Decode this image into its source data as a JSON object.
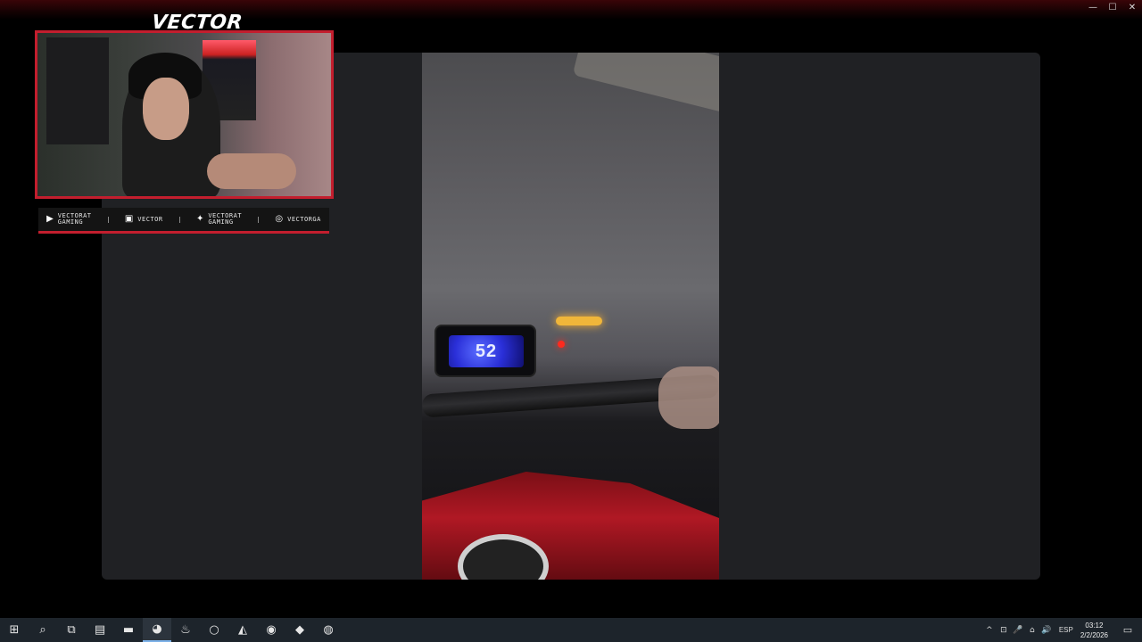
{
  "window": {
    "minimize_glyph": "—",
    "maximize_glyph": "☐",
    "close_glyph": "✕"
  },
  "overlay": {
    "logo_text": "VECTOR",
    "accent_color": "#c31e2e",
    "socials": [
      {
        "icon": "youtube-icon",
        "glyph": "▶",
        "text": "VECTORAT\nGAMING"
      },
      {
        "icon": "twitch-icon",
        "glyph": "▣",
        "text": "VECTOR"
      },
      {
        "icon": "twitter-icon",
        "glyph": "✦",
        "text": "VECTORAT\nGAMING"
      },
      {
        "icon": "instagram-icon",
        "glyph": "◎",
        "text": "VECTORGA"
      }
    ]
  },
  "video": {
    "dash_speed": "52"
  },
  "taskbar": {
    "apps": [
      {
        "name": "windows-start-icon",
        "glyph": "⊞"
      },
      {
        "name": "search-icon",
        "glyph": "⌕"
      },
      {
        "name": "task-view-icon",
        "glyph": "⧉"
      },
      {
        "name": "desktop-app-icon",
        "glyph": "▤"
      },
      {
        "name": "file-explorer-icon",
        "glyph": "▬"
      },
      {
        "name": "discord-icon",
        "glyph": "◕",
        "active": true
      },
      {
        "name": "steam-icon",
        "glyph": "♨"
      },
      {
        "name": "opera-icon",
        "glyph": "○"
      },
      {
        "name": "unity-icon",
        "glyph": "◭"
      },
      {
        "name": "spotify-icon",
        "glyph": "◉"
      },
      {
        "name": "brave-icon",
        "glyph": "◆"
      },
      {
        "name": "obs-icon",
        "glyph": "◍"
      }
    ],
    "tray": {
      "chevron": "^",
      "icons": [
        "⊡",
        "🎤",
        "⌂",
        "🔊"
      ],
      "language": "ESP",
      "time": "03:12",
      "date": "2/2/2026",
      "notification_glyph": "▭"
    }
  }
}
